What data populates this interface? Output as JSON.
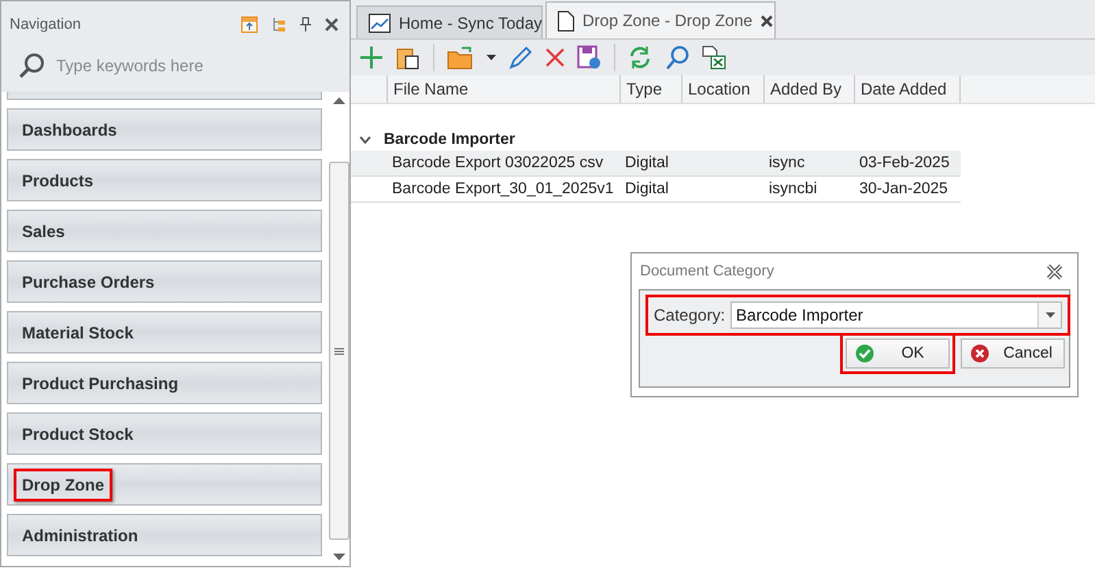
{
  "navigation": {
    "title": "Navigation",
    "search": {
      "placeholder": "Type keywords here"
    },
    "items": [
      {
        "label": "Dashboards",
        "highlighted": false
      },
      {
        "label": "Products",
        "highlighted": false
      },
      {
        "label": "Sales",
        "highlighted": false
      },
      {
        "label": "Purchase Orders",
        "highlighted": false
      },
      {
        "label": "Material Stock",
        "highlighted": false
      },
      {
        "label": "Product Purchasing",
        "highlighted": false
      },
      {
        "label": "Product Stock",
        "highlighted": false
      },
      {
        "label": "Drop Zone",
        "highlighted": true
      },
      {
        "label": "Administration",
        "highlighted": false
      }
    ]
  },
  "tabs": [
    {
      "label": "Home - Sync Today",
      "selected": false,
      "kind": "chart"
    },
    {
      "label": "Drop Zone - Drop Zone",
      "selected": true,
      "kind": "document"
    }
  ],
  "table": {
    "columns": [
      "File Name",
      "Type",
      "Location",
      "Added By",
      "Date Added"
    ],
    "group": {
      "label": "Barcode Importer",
      "expanded": true
    },
    "rows": [
      {
        "cells": [
          "Barcode Export 03022025 csv",
          "Digital",
          "",
          "isync",
          "03-Feb-2025"
        ],
        "selected": true
      },
      {
        "cells": [
          "Barcode Export_30_01_2025v1",
          "Digital",
          "",
          "isyncbi",
          "30-Jan-2025"
        ],
        "selected": false
      }
    ]
  },
  "dialog": {
    "title": "Document Category",
    "category_label": "Category:",
    "category_value": "Barcode Importer",
    "category_highlighted": true,
    "buttons": [
      {
        "label": "OK",
        "kind": "ok",
        "highlighted": true
      },
      {
        "label": "Cancel",
        "kind": "cancel",
        "highlighted": false
      }
    ]
  }
}
